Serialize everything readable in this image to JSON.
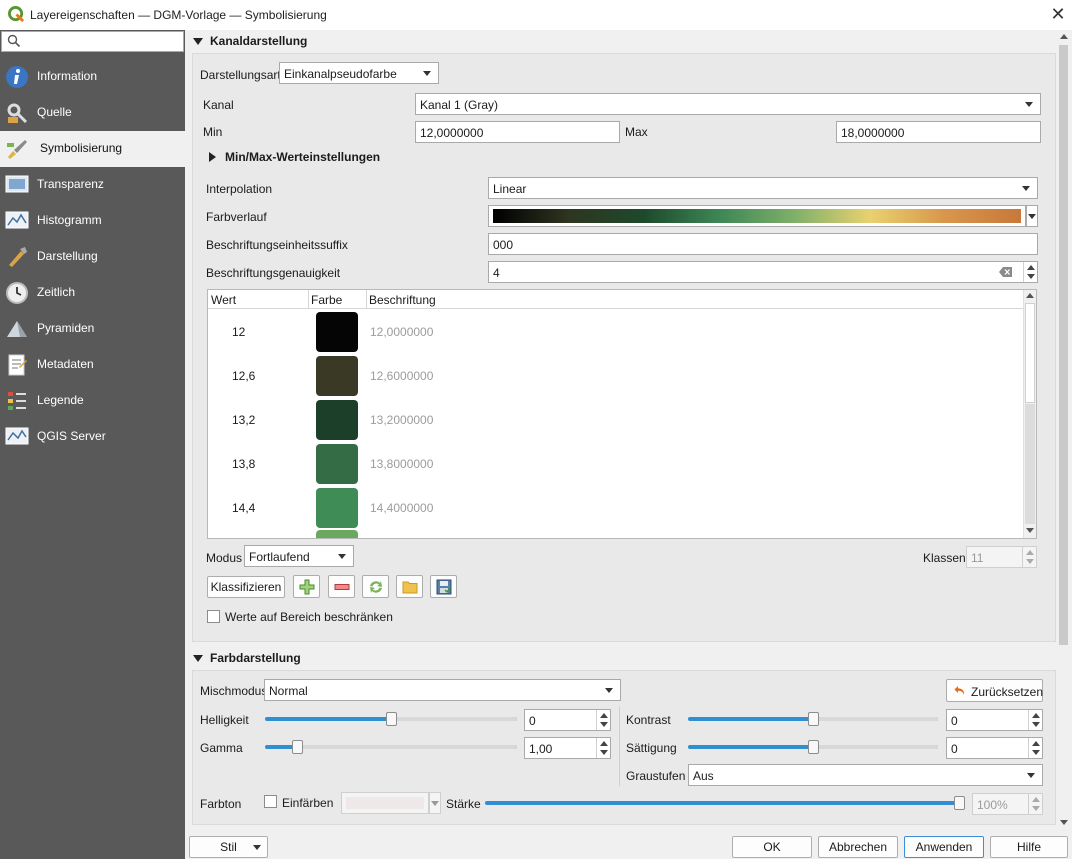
{
  "window": {
    "title": "Layereigenschaften — DGM-Vorlage — Symbolisierung",
    "close_glyph": "✕"
  },
  "search": {
    "value": "",
    "icon": "search-icon"
  },
  "sidebar": {
    "items": [
      {
        "label": "Information",
        "icon": "info-icon",
        "active": false
      },
      {
        "label": "Quelle",
        "icon": "source-icon",
        "active": false
      },
      {
        "label": "Symbolisierung",
        "icon": "paintbrush-icon",
        "active": true
      },
      {
        "label": "Transparenz",
        "icon": "transparency-icon",
        "active": false
      },
      {
        "label": "Histogramm",
        "icon": "histogram-icon",
        "active": false
      },
      {
        "label": "Darstellung",
        "icon": "rendering-icon",
        "active": false
      },
      {
        "label": "Zeitlich",
        "icon": "clock-icon",
        "active": false
      },
      {
        "label": "Pyramiden",
        "icon": "pyramid-icon",
        "active": false
      },
      {
        "label": "Metadaten",
        "icon": "metadata-icon",
        "active": false
      },
      {
        "label": "Legende",
        "icon": "legend-icon",
        "active": false
      },
      {
        "label": "QGIS Server",
        "icon": "server-icon",
        "active": false
      }
    ]
  },
  "band": {
    "section_title": "Kanaldarstellung",
    "render_type_label": "Darstellungsart",
    "render_type_value": "Einkanalpseudofarbe",
    "band_label": "Kanal",
    "band_value": "Kanal 1 (Gray)",
    "min_label": "Min",
    "min_value": "12,0000000",
    "max_label": "Max",
    "max_value": "18,0000000",
    "minmax_settings_label": "Min/Max-Werteinstellungen",
    "interpolation_label": "Interpolation",
    "interpolation_value": "Linear",
    "color_ramp_label": "Farbverlauf",
    "color_ramp_stops": [
      "#000000",
      "#2e3520",
      "#1d4a2c",
      "#3e8655",
      "#7fb06a",
      "#e9d170",
      "#d8964b",
      "#c8783a"
    ],
    "label_suffix_label": "Beschriftungseinheitssuffix",
    "label_suffix_value": "000",
    "label_precision_label": "Beschriftungsgenauigkeit",
    "label_precision_value": "4",
    "table": {
      "headers": [
        "Wert",
        "Farbe",
        "Beschriftung"
      ],
      "rows": [
        {
          "value": "12",
          "color": "#050505",
          "label": "12,0000000"
        },
        {
          "value": "12,6",
          "color": "#3a3925",
          "label": "12,6000000"
        },
        {
          "value": "13,2",
          "color": "#1c3f2a",
          "label": "13,2000000"
        },
        {
          "value": "13,8",
          "color": "#336c45",
          "label": "13,8000000"
        },
        {
          "value": "14,4",
          "color": "#3f8c57",
          "label": "14,4000000"
        }
      ],
      "partial_row_color": "#6aa85e"
    },
    "mode_label": "Modus",
    "mode_value": "Fortlaufend",
    "classes_label": "Klassen",
    "classes_value": "11",
    "classify_button": "Klassifizieren",
    "clip_checkbox_label": "Werte auf Bereich beschränken"
  },
  "color_rendering": {
    "section_title": "Farbdarstellung",
    "blend_label": "Mischmodus",
    "blend_value": "Normal",
    "reset_button": "Zurücksetzen",
    "brightness_label": "Helligkeit",
    "brightness_value": "0",
    "brightness_level": 0.5,
    "contrast_label": "Kontrast",
    "contrast_value": "0",
    "contrast_level": 0.5,
    "gamma_label": "Gamma",
    "gamma_value": "1,00",
    "gamma_level": 0.11,
    "saturation_label": "Sättigung",
    "saturation_value": "0",
    "saturation_level": 0.5,
    "grayscale_label": "Graustufen",
    "grayscale_value": "Aus",
    "hue_label": "Farbton",
    "colorize_label": "Einfärben",
    "strength_label": "Stärke",
    "strength_value": "100%",
    "strength_level": 1.0
  },
  "footer": {
    "style_button": "Stil",
    "ok_button": "OK",
    "cancel_button": "Abbrechen",
    "apply_button": "Anwenden",
    "help_button": "Hilfe"
  },
  "colors": {
    "sidebar_bg": "#595959",
    "accent": "#2f8fd0",
    "qgis_green": "#589632"
  }
}
